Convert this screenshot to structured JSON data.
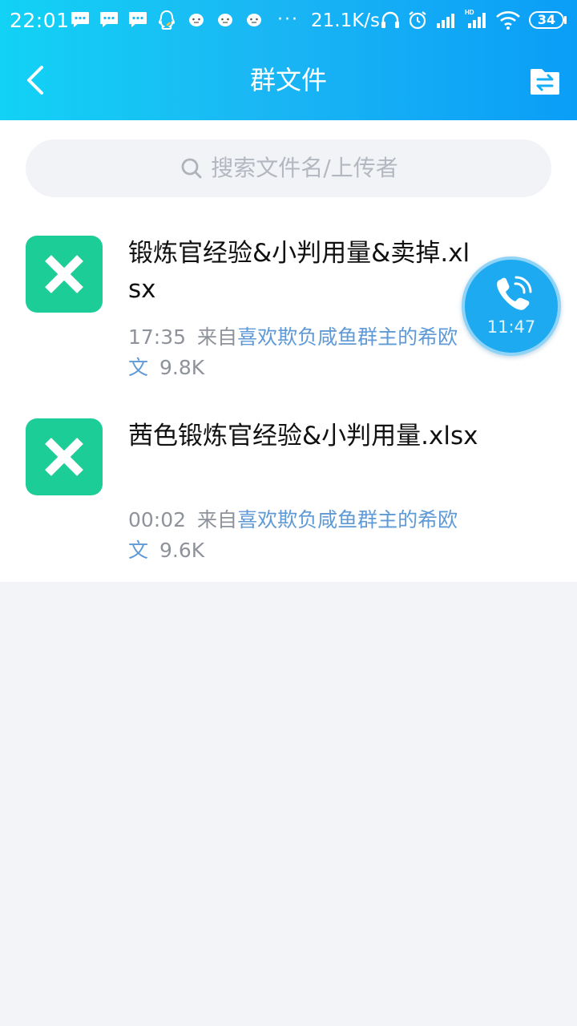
{
  "status_bar": {
    "time": "22:01",
    "overflow_dots": "···",
    "network_speed": "21.1K/s",
    "battery_level": "34",
    "icons": [
      "message-icon",
      "message-icon",
      "message-icon",
      "qq-notification-icon",
      "emoji-icon",
      "emoji-icon",
      "emoji-icon",
      "headphones-icon",
      "alarm-icon",
      "signal-icon",
      "hd-signal-icon",
      "wifi-icon",
      "battery-icon"
    ]
  },
  "header": {
    "title": "群文件",
    "back_icon": "chevron-left-icon",
    "action_icon": "file-transfer-icon",
    "gradient_colors": [
      "#12d2f5",
      "#0a9ef7"
    ]
  },
  "search": {
    "placeholder": "搜索文件名/上传者",
    "icon": "search-icon"
  },
  "files": [
    {
      "name": "锻炼官经验&小判用量&卖掉.xlsx",
      "time": "17:35",
      "from_label": "来自",
      "uploader": "喜欢欺负咸鱼群主的希欧文",
      "size": "9.8K",
      "icon": "excel-file-icon"
    },
    {
      "name": "茜色锻炼官经验&小判用量.xlsx",
      "time": "00:02",
      "from_label": "来自",
      "uploader": "喜欢欺负咸鱼群主的希欧文",
      "size": "9.6K",
      "icon": "excel-file-icon"
    }
  ],
  "call_bubble": {
    "duration": "11:47",
    "icon": "phone-icon"
  },
  "colors": {
    "excel_green": "#1ccd98",
    "uploader_link": "#5f9ad7",
    "meta_gray": "#8e939b",
    "page_background": "#f2f4f8"
  }
}
